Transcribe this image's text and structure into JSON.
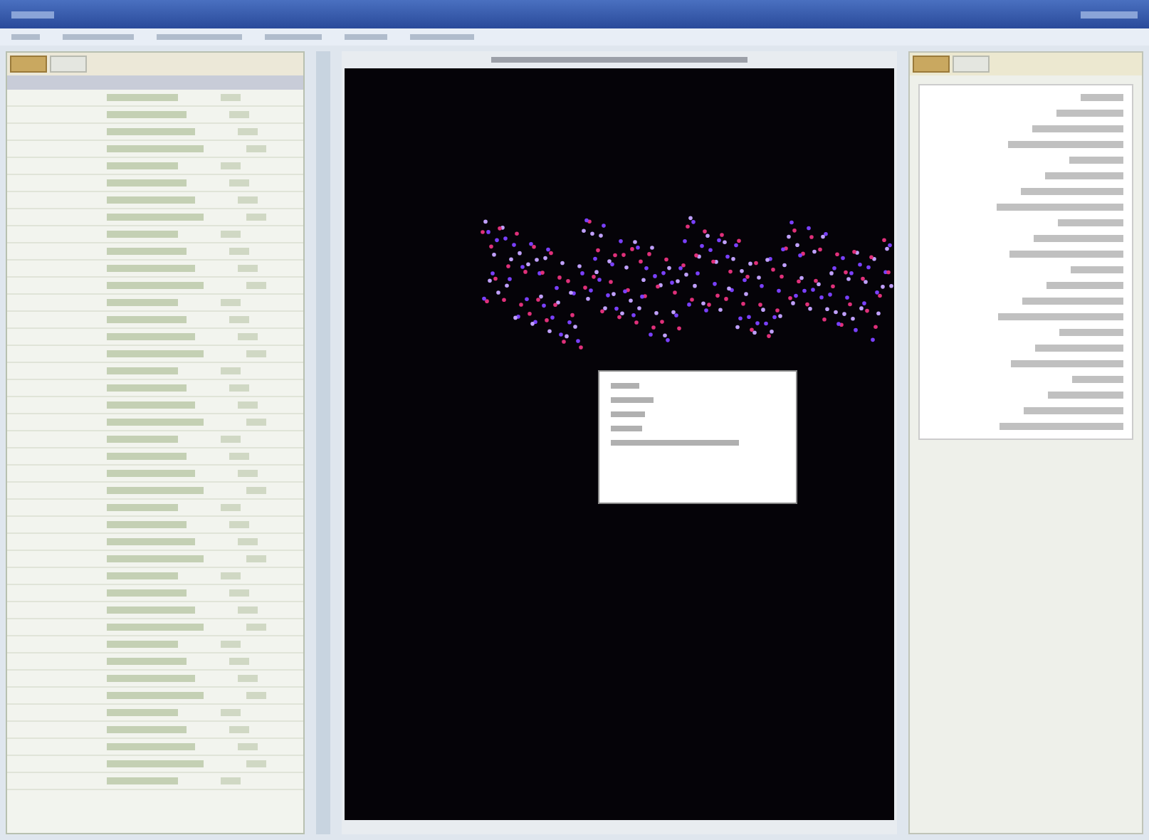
{
  "left_tabs": [
    {
      "selected": true
    },
    {
      "selected": false
    }
  ],
  "right_tabs": [
    {
      "selected": true
    },
    {
      "selected": false
    }
  ]
}
